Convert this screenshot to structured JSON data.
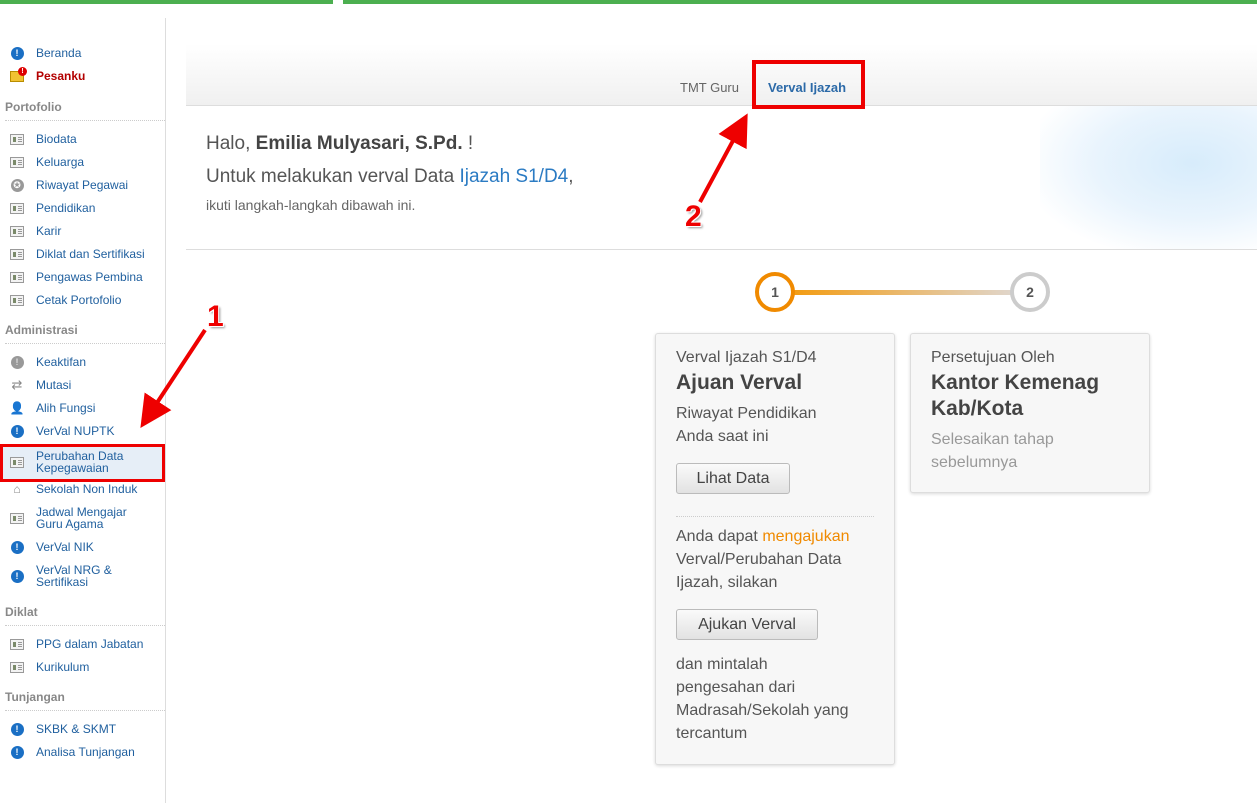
{
  "sidebar": {
    "top_items": [
      {
        "label": "Beranda",
        "icon": "info-icon"
      },
      {
        "label": "Pesanku",
        "icon": "mail-alert-icon"
      }
    ],
    "sections": [
      {
        "title": "Portofolio",
        "items": [
          "Biodata",
          "Keluarga",
          "Riwayat Pegawai",
          "Pendidikan",
          "Karir",
          "Diklat dan Sertifikasi",
          "Pengawas Pembina",
          "Cetak Portofolio"
        ]
      },
      {
        "title": "Administrasi",
        "items": [
          "Keaktifan",
          "Mutasi",
          "Alih Fungsi",
          "VerVal NUPTK",
          "Perubahan Data Kepegawaian",
          "Sekolah Non Induk",
          "Jadwal Mengajar Guru Agama",
          "VerVal NIK",
          "VerVal NRG & Sertifikasi"
        ]
      },
      {
        "title": "Diklat",
        "items": [
          "PPG dalam Jabatan",
          "Kurikulum"
        ]
      },
      {
        "title": "Tunjangan",
        "items": [
          "SKBK & SKMT",
          "Analisa Tunjangan"
        ]
      }
    ]
  },
  "tabs": {
    "tmt": "TMT Guru",
    "verval": "Verval Ijazah"
  },
  "greeting": {
    "hello": "Halo,",
    "name": "Emilia Mulyasari, S.Pd.",
    "exclaim": "!",
    "line2_prefix": "Untuk melakukan verval Data",
    "line2_link": "Ijazah S1/D4",
    "line2_suffix": ",",
    "line3": "ikuti langkah-langkah dibawah ini."
  },
  "steps": {
    "step1_number": "1",
    "step2_number": "2",
    "card1": {
      "subtitle": "Verval Ijazah S1/D4",
      "title": "Ajuan Verval",
      "desc1": "Riwayat Pendidikan",
      "desc2": "Anda saat ini",
      "lihat_button": "Lihat Data",
      "p1": "Anda dapat",
      "p1_highlight": "mengajukan",
      "p2": "Verval/Perubahan Data",
      "p3": "Ijazah, silakan",
      "ajukan_button": "Ajukan Verval",
      "f1": "dan mintalah",
      "f2": "pengesahan dari",
      "f3": "Madrasah/Sekolah yang",
      "f4": "tercantum"
    },
    "card2": {
      "subtitle": "Persetujuan Oleh",
      "title1": "Kantor Kemenag",
      "title2": "Kab/Kota",
      "note1": "Selesaikan tahap",
      "note2": "sebelumnya"
    }
  },
  "annotations": {
    "one": "1",
    "two": "2"
  },
  "colors": {
    "accent": "#f08a00",
    "link": "#2b7bc3",
    "annotation": "#e00000",
    "topbar": "#4caf50"
  }
}
